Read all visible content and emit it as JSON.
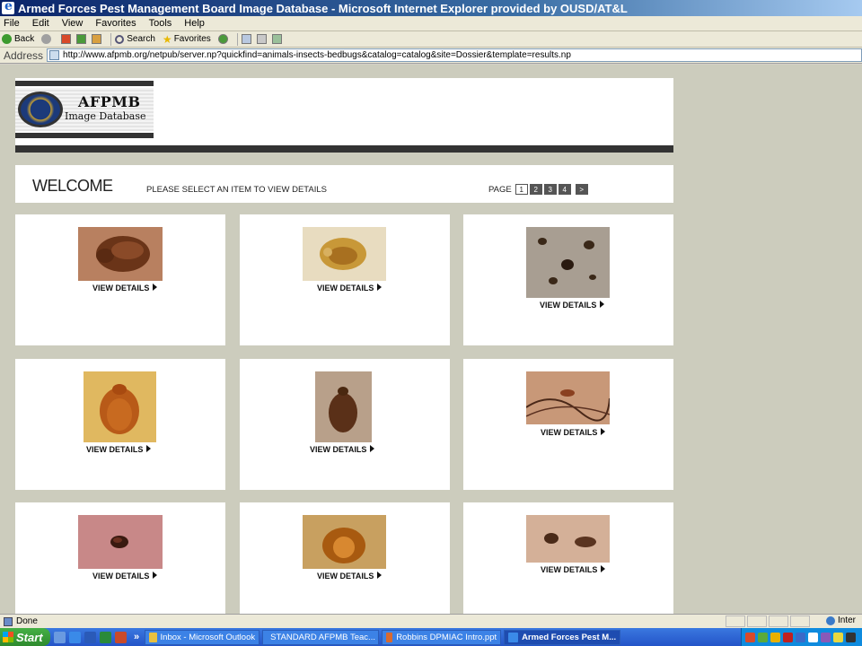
{
  "window": {
    "title": "Armed Forces Pest Management Board Image Database - Microsoft Internet Explorer provided by OUSD/AT&L"
  },
  "menu": [
    "File",
    "Edit",
    "View",
    "Favorites",
    "Tools",
    "Help"
  ],
  "toolbar": {
    "back_label": "Back",
    "search_label": "Search",
    "favorites_label": "Favorites"
  },
  "address": {
    "label": "Address",
    "url": "http://www.afpmb.org/netpub/server.np?quickfind=animals-insects-bedbugs&catalog=catalog&site=Dossier&template=results.np"
  },
  "logo": {
    "title": "AFPMB",
    "subtitle": "Image Database"
  },
  "welcome": {
    "title": "WELCOME",
    "instruction": "PLEASE SELECT AN ITEM TO VIEW DETAILS",
    "page_label": "PAGE",
    "pages": [
      "1",
      "2",
      "3",
      "4",
      ">"
    ]
  },
  "cards": [
    {
      "cta": "VIEW DETAILS",
      "image": "bedbug-photo-1"
    },
    {
      "cta": "VIEW DETAILS",
      "image": "bedbug-photo-2"
    },
    {
      "cta": "VIEW DETAILS",
      "image": "bedbug-photo-3"
    },
    {
      "cta": "VIEW DETAILS",
      "image": "bedbug-photo-4"
    },
    {
      "cta": "VIEW DETAILS",
      "image": "bedbug-photo-5"
    },
    {
      "cta": "VIEW DETAILS",
      "image": "bedbug-photo-6"
    },
    {
      "cta": "VIEW DETAILS",
      "image": "bedbug-photo-7"
    },
    {
      "cta": "VIEW DETAILS",
      "image": "bedbug-photo-8"
    },
    {
      "cta": "VIEW DETAILS",
      "image": "bedbug-photo-9"
    }
  ],
  "status": {
    "text": "Done",
    "zone": "Inter"
  },
  "taskbar": {
    "start_label": "Start",
    "overflow": "»",
    "tasks": [
      "Inbox - Microsoft Outlook",
      "STANDARD AFPMB Teac...",
      "Robbins DPMIAC Intro.ppt",
      "Armed Forces Pest M..."
    ]
  }
}
